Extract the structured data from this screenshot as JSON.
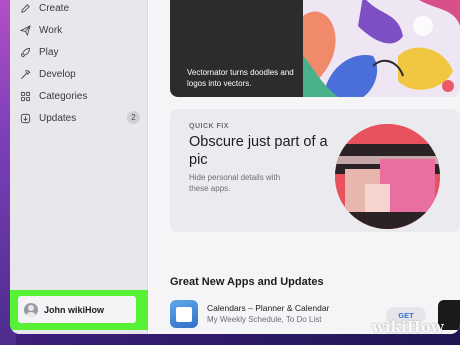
{
  "sidebar": {
    "items": [
      {
        "label": "Create",
        "icon": "pencil-icon"
      },
      {
        "label": "Work",
        "icon": "paper-plane-icon"
      },
      {
        "label": "Play",
        "icon": "rocket-icon"
      },
      {
        "label": "Develop",
        "icon": "hammer-icon"
      },
      {
        "label": "Categories",
        "icon": "grid-icon"
      },
      {
        "label": "Updates",
        "icon": "download-icon",
        "badge": "2"
      }
    ],
    "user": {
      "name": "John wikiHow",
      "icon": "avatar-icon"
    }
  },
  "main": {
    "top_card": {
      "caption": "Vectornator turns doodles and logos into vectors."
    },
    "feature_card": {
      "eyebrow": "QUICK FIX",
      "headline": "Obscure just part of a pic",
      "subline": "Hide personal details with these apps."
    },
    "section_title": "Great New Apps and Updates",
    "apps": [
      {
        "name": "Calendars – Planner & Calendar",
        "subtitle": "My Weekly Schedule, To Do List",
        "action": "GET"
      }
    ]
  },
  "watermark": "wikiHow",
  "colors": {
    "highlight": "#57f236",
    "accent": "#2f6fd8"
  }
}
